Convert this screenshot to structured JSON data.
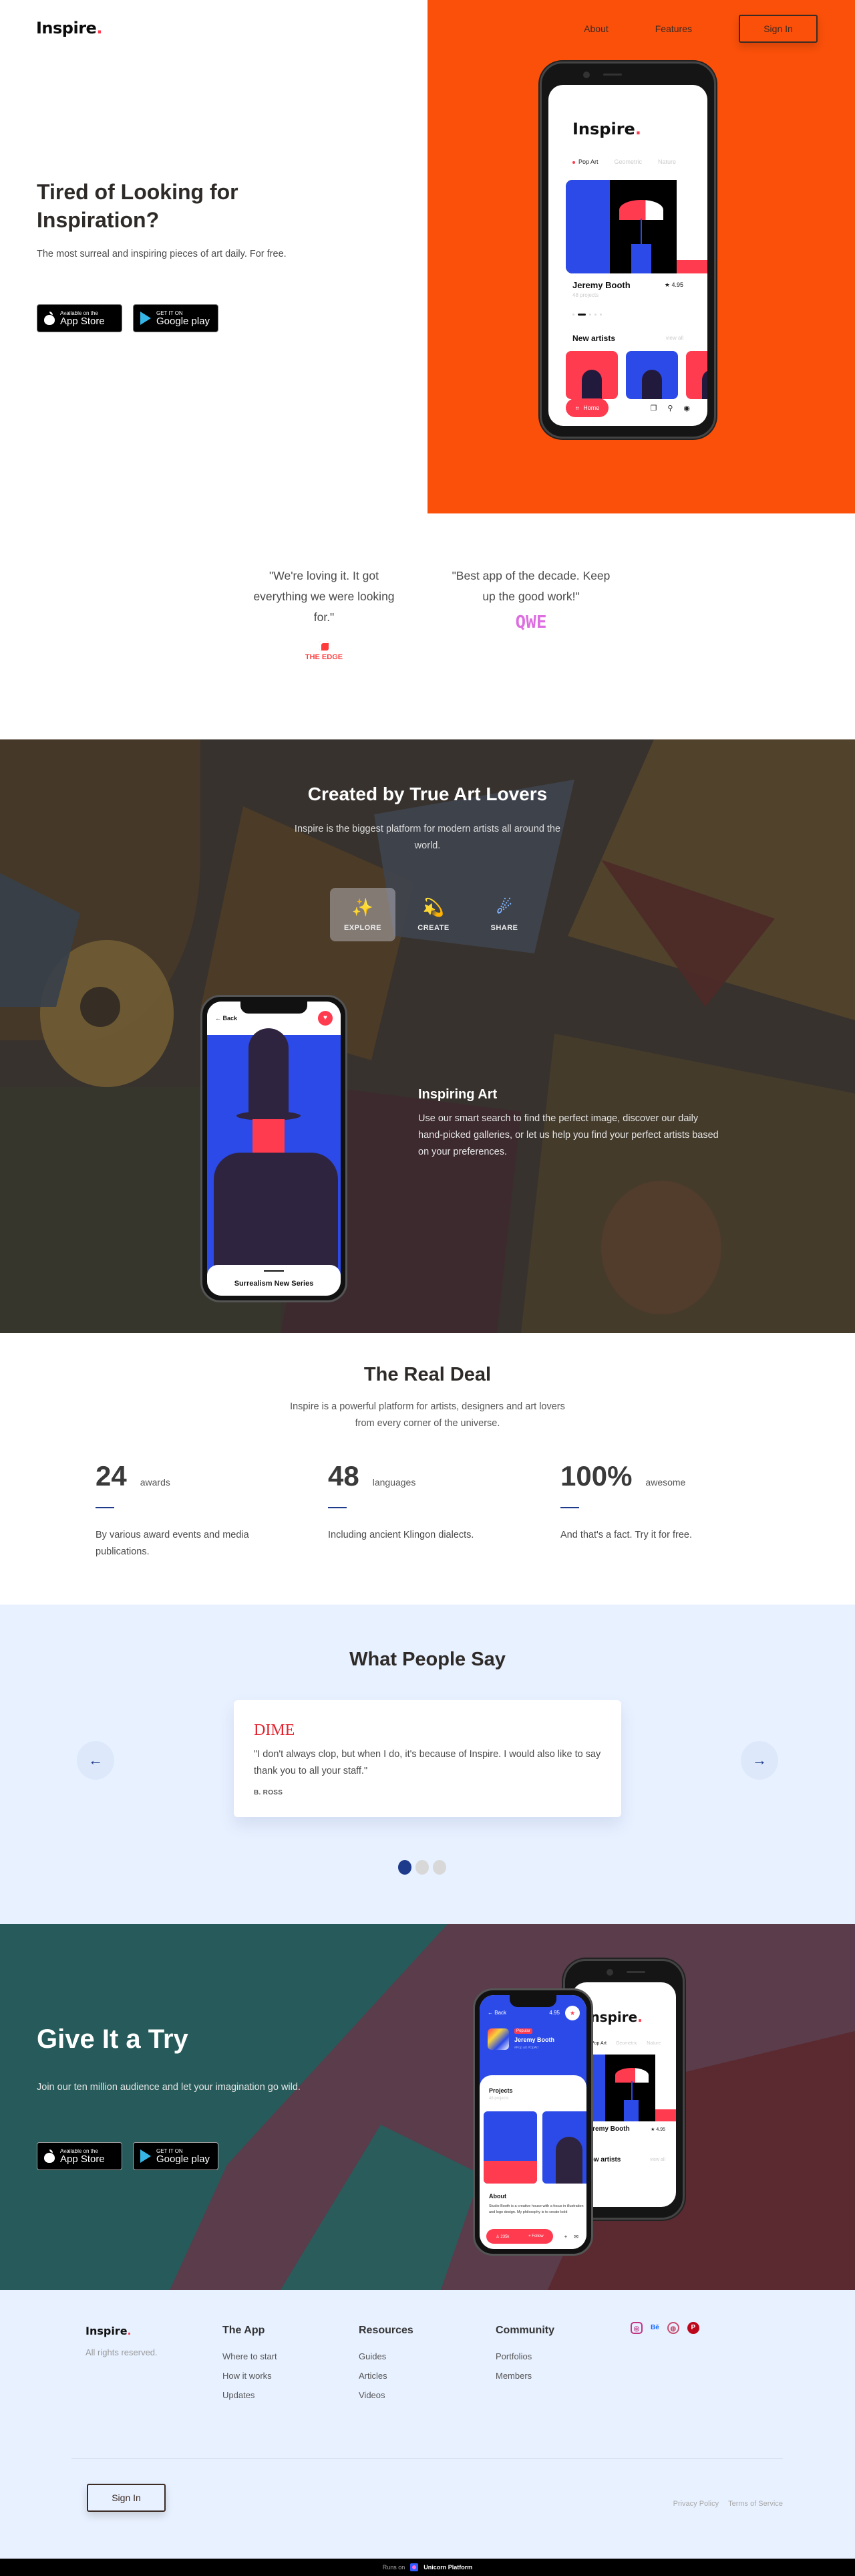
{
  "brand": {
    "name": "Inspire",
    "dot": ".",
    "accent": "#ff3b4f"
  },
  "nav": {
    "items": [
      "About",
      "Features"
    ],
    "signin": "Sign In"
  },
  "hero": {
    "title": "Tired of Looking for Inspiration?",
    "subtitle": "The most surreal and inspiring pieces of art daily. For free.",
    "bg_color": "#fa500a",
    "appstore": {
      "small": "Available on the",
      "big": "App Store"
    },
    "googleplay": {
      "small": "GET IT ON",
      "big": "Google play"
    },
    "phone": {
      "logo": "Inspire",
      "tabs": [
        "Pop Art",
        "Geometric",
        "Nature"
      ],
      "artist_name": "Jeremy Booth",
      "artist_projects": "48 projects",
      "rating": "4.95",
      "new_artists": "New artists",
      "view_all": "view all",
      "home": "Home"
    }
  },
  "press": [
    {
      "quote": "\"We're loving it. It got everything we were looking for.\"",
      "source": "THE EDGE"
    },
    {
      "quote": "\"Best app of the decade. Keep up the good work!\"",
      "source": "QWE"
    }
  ],
  "created": {
    "title": "Created by True Art Lovers",
    "subtitle": "Inspire is the biggest platform for modern artists all around the world.",
    "tabs": [
      {
        "label": "EXPLORE",
        "icon": "sparkles-icon",
        "glyph": "✨",
        "active": true
      },
      {
        "label": "CREATE",
        "icon": "shooting-star-icon",
        "glyph": "💫",
        "active": false
      },
      {
        "label": "SHARE",
        "icon": "comet-icon",
        "glyph": "☄",
        "active": false
      }
    ],
    "phone": {
      "back": "Back",
      "caption": "Surrealism New Series"
    },
    "feature_title": "Inspiring Art",
    "feature_text": "Use our smart search to find the perfect image, discover our daily hand-picked galleries, or let us help you find your perfect artists based on your preferences."
  },
  "deal": {
    "title": "The Real Deal",
    "subtitle": "Inspire is a powerful platform for artists, designers and art lovers from every corner of the universe.",
    "stats": [
      {
        "num": "24",
        "unit": "awards",
        "desc": "By various award events and media publications."
      },
      {
        "num": "48",
        "unit": "languages",
        "desc": "Including ancient Klingon dialects."
      },
      {
        "num": "100%",
        "unit": "awesome",
        "desc": "And that's a fact. Try it for free."
      }
    ]
  },
  "testimonials": {
    "title": "What People Say",
    "brand": "DIME",
    "quote": "\"I don't always clop, but when I do, it's because of Inspire. I would also like to say thank you to all your staff.\"",
    "author": "B. ROSS",
    "prev": "←",
    "next": "→",
    "active_index": 0,
    "count": 3
  },
  "try": {
    "title": "Give It a Try",
    "subtitle": "Join our ten million audience and let your imagination go wild.",
    "phone_front": {
      "back": "Back",
      "rating": "4.95",
      "badge": "Popular",
      "name": "Jeremy Booth",
      "tags": "#Pop art #OpArt",
      "projects": "Projects",
      "projects_count": "48 projects",
      "about": "About",
      "about_text": "Studio Booth is a creative house with a focus in illustration and logo design. My philosophy is to create bold",
      "followers": "235k",
      "follow": "+ Follow"
    },
    "phone_back": {
      "logo": "Inspire",
      "tabs": [
        "Pop Art",
        "Geometric",
        "Nature"
      ],
      "name": "Jeremy Booth",
      "rating": "4.95",
      "new_artists": "New artists",
      "view_all": "view all"
    }
  },
  "footer": {
    "rights": "All rights reserved.",
    "columns": [
      {
        "title": "The App",
        "links": [
          "Where to start",
          "How it works",
          "Updates"
        ]
      },
      {
        "title": "Resources",
        "links": [
          "Guides",
          "Articles",
          "Videos"
        ]
      },
      {
        "title": "Community",
        "links": [
          "Portfolios",
          "Members"
        ]
      }
    ],
    "socials": [
      "instagram",
      "behance",
      "dribbble",
      "pinterest"
    ],
    "signin": "Sign In",
    "legal": [
      "Privacy Policy",
      "Terms of Service"
    ],
    "runs_on": "Runs on",
    "platform": "Unicorn Platform"
  }
}
